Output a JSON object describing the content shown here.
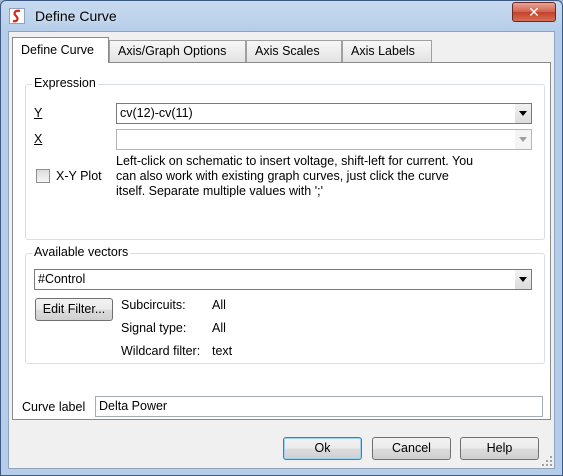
{
  "window": {
    "title": "Define Curve",
    "close_label": "✕"
  },
  "tabs": [
    {
      "label": "Define Curve",
      "active": true
    },
    {
      "label": "Axis/Graph Options",
      "active": false
    },
    {
      "label": "Axis Scales",
      "active": false
    },
    {
      "label": "Axis Labels",
      "active": false
    }
  ],
  "expression": {
    "group_title": "Expression",
    "y_label": "Y",
    "y_value": "cv(12)-cv(11)",
    "x_label": "X",
    "x_value": "",
    "xy_plot_label": "X-Y Plot",
    "xy_plot_checked": false,
    "hint": "Left-click on schematic to insert voltage, shift-left for current. You can also work with existing graph curves, just click the curve itself. Separate multiple values with ';'"
  },
  "vectors": {
    "group_title": "Available vectors",
    "selected": "#Control",
    "edit_filter_label": "Edit Filter...",
    "subcircuits_label": "Subcircuits:",
    "subcircuits_value": "All",
    "signal_type_label": "Signal type:",
    "signal_type_value": "All",
    "wildcard_label": "Wildcard filter:",
    "wildcard_value": "text"
  },
  "curve_label": {
    "label": "Curve label",
    "value": "Delta Power"
  },
  "buttons": {
    "ok": "Ok",
    "cancel": "Cancel",
    "help": "Help"
  },
  "colors": {
    "accent": "#3c7fb1",
    "title_bar": "#b6cde9",
    "close": "#c4412b"
  }
}
